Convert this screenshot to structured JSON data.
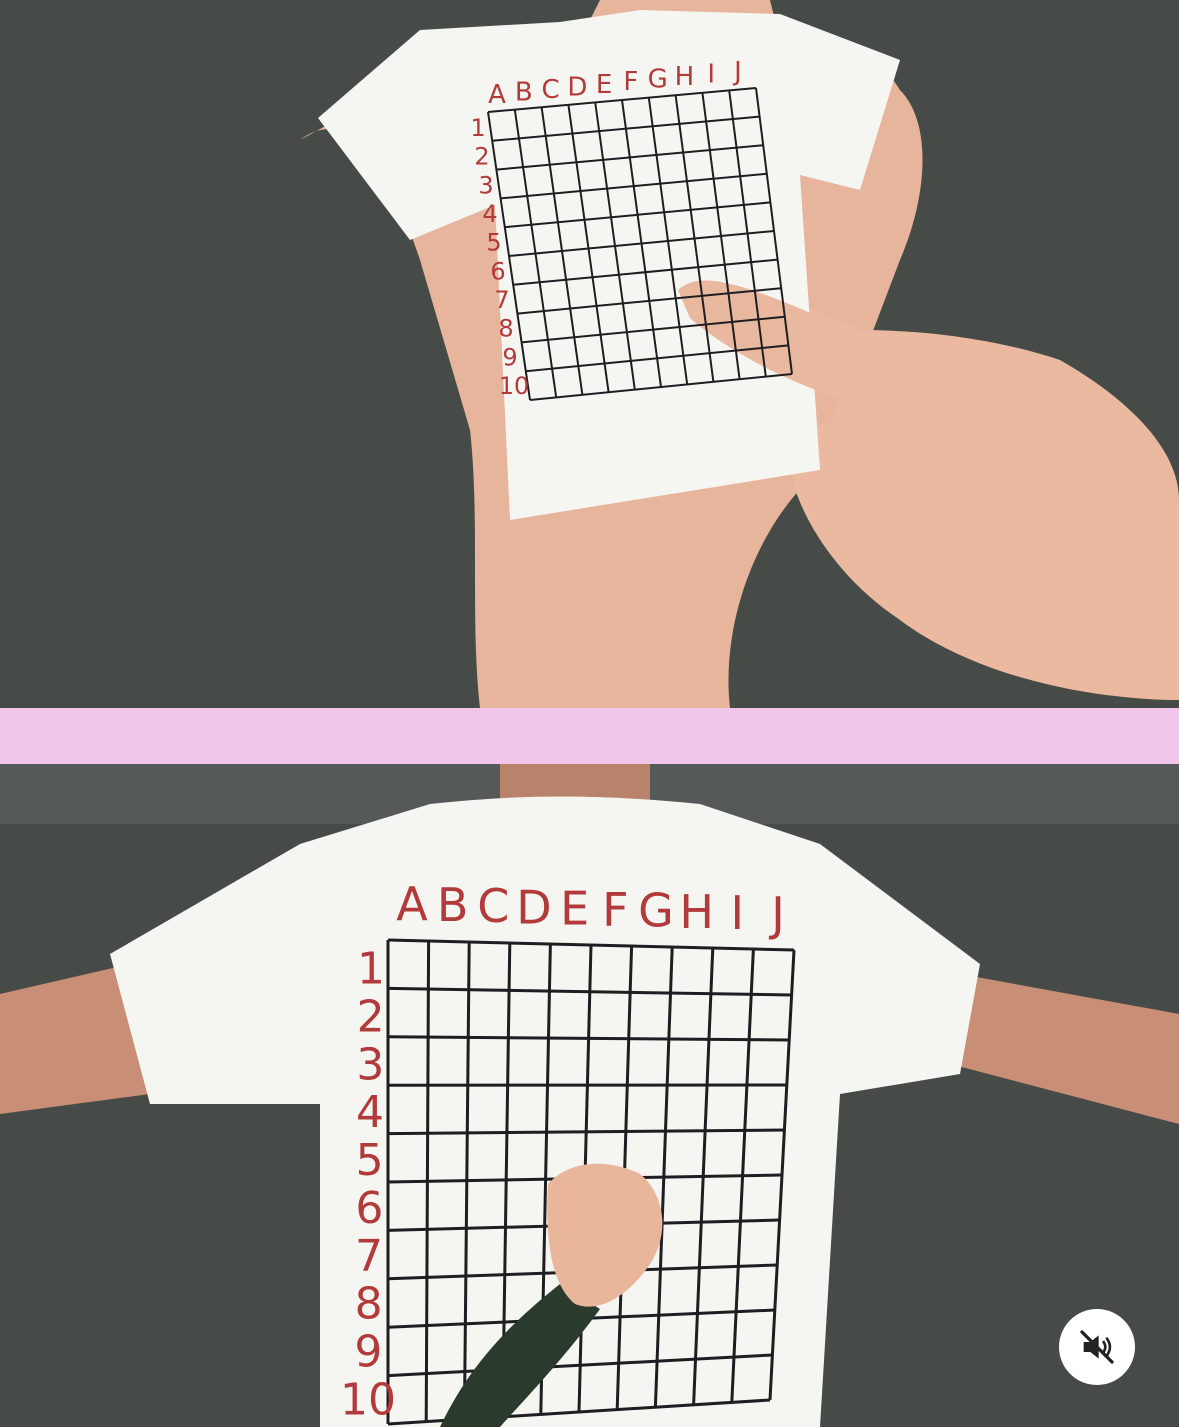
{
  "top_photo": {
    "column_letters": [
      "A",
      "B",
      "C",
      "D",
      "E",
      "F",
      "G",
      "H",
      "I",
      "J"
    ],
    "row_numbers": [
      "1",
      "2",
      "3",
      "4",
      "5",
      "6",
      "7",
      "8",
      "9",
      "10"
    ]
  },
  "bottom_photo": {
    "column_letters": [
      "A",
      "B",
      "C",
      "D",
      "E",
      "F",
      "G",
      "H",
      "I",
      "J"
    ],
    "row_numbers": [
      "1",
      "2",
      "3",
      "4",
      "5",
      "6",
      "7",
      "8",
      "9",
      "10"
    ]
  },
  "controls": {
    "mute_icon": "speaker-muted-icon"
  },
  "colors": {
    "background": "#3f4442",
    "pink_band": "#f2c6ea",
    "shirt": "#f5f5f2",
    "label_red": "#b33a3a",
    "grid_ink": "#1e1e22",
    "skin": "#e6b8a0",
    "mute_bg": "#ffffff",
    "mute_icon": "#222222"
  }
}
